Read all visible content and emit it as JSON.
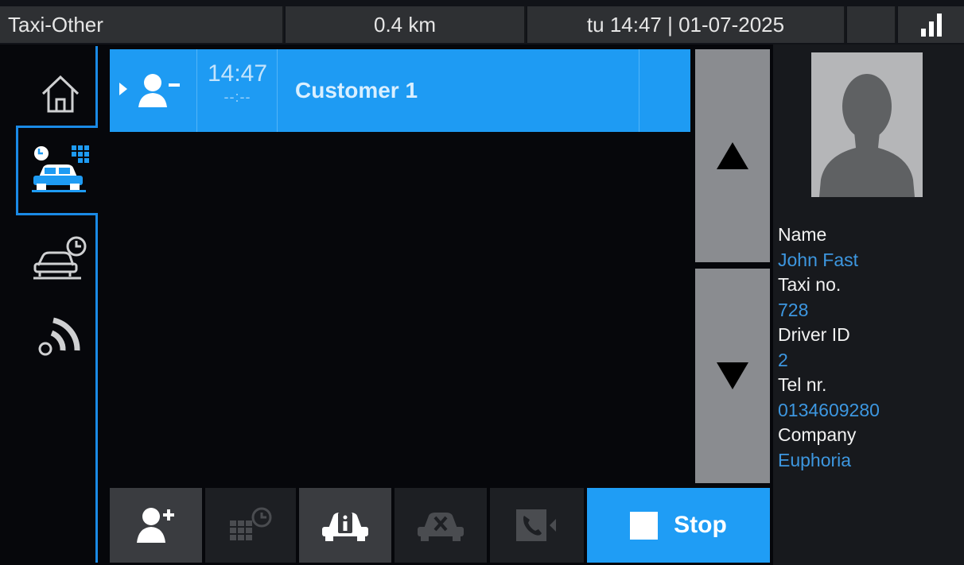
{
  "status_bar": {
    "status": "Taxi-Other",
    "distance": "0.4 km",
    "datetime": "tu 14:47 | 01-07-2025"
  },
  "nav": {
    "items": [
      {
        "icon": "home-icon"
      },
      {
        "icon": "taxi-trips-icon",
        "active": true
      },
      {
        "icon": "taxi-schedule-icon"
      },
      {
        "icon": "signal-broadcast-icon"
      }
    ]
  },
  "trips": [
    {
      "pickup_time": "14:47",
      "dropoff_time": "--:--",
      "customer": "Customer 1",
      "selected": true
    }
  ],
  "driver": {
    "name_label": "Name",
    "name": "John Fast",
    "taxi_label": "Taxi no.",
    "taxi": "728",
    "driver_id_label": "Driver ID",
    "driver_id": "2",
    "tel_label": "Tel nr.",
    "tel": "0134609280",
    "company_label": "Company",
    "company": "Euphoria"
  },
  "toolbar": {
    "stop_label": "Stop"
  },
  "colors": {
    "accent": "#1e9bf3",
    "value_text": "#3d97e0",
    "scroll_button": "#8a8c90"
  }
}
